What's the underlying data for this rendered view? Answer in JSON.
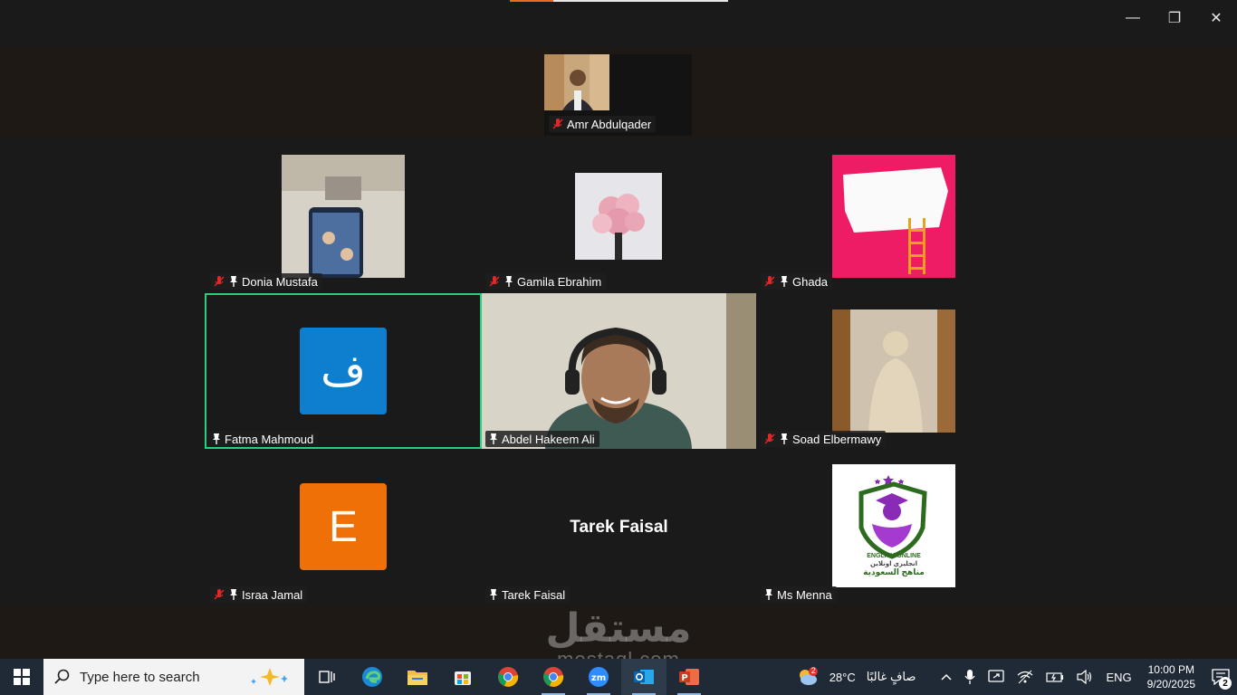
{
  "window": {
    "minimize_glyph": "—",
    "restore_glyph": "❐",
    "close_glyph": "✕",
    "load_progress": 0.2
  },
  "speaker": {
    "name": "Amr Abdulqader",
    "muted": true
  },
  "participants": [
    {
      "name": "Donia Mustafa",
      "muted": true,
      "pinned": true
    },
    {
      "name": "Gamila Ebrahim",
      "muted": true,
      "pinned": true
    },
    {
      "name": "Ghada",
      "muted": true,
      "pinned": true
    },
    {
      "name": "Fatma Mahmoud",
      "muted": false,
      "pinned": true,
      "avatar_letter": "ف",
      "avatar_color": "#0e7fcf",
      "active": true
    },
    {
      "name": "Abdel Hakeem Ali",
      "muted": false,
      "pinned": true
    },
    {
      "name": "Soad Elbermawy",
      "muted": true,
      "pinned": true
    },
    {
      "name": "Israa Jamal",
      "muted": true,
      "pinned": true,
      "avatar_letter": "E",
      "avatar_color": "#ee7007"
    },
    {
      "name": "Tarek Faisal",
      "muted": false,
      "pinned": true,
      "center_name": "Tarek Faisal"
    },
    {
      "name": "Ms Menna",
      "muted": false,
      "pinned": true,
      "logo_text_en": "ENGLISH ONLINE",
      "logo_text_ar1": "انجليزي اونلاين",
      "logo_text_ar2": "مناهج السعودية"
    }
  ],
  "watermark": {
    "arabic": "مستقل",
    "latin": "mostaql.com"
  },
  "taskbar": {
    "search_placeholder": "Type here to search",
    "weather_temp": "28°C",
    "weather_desc": "صافٍ غالبًا",
    "weather_badge": "2",
    "language": "ENG",
    "time": "10:00 PM",
    "date": "9/20/2025",
    "notification_count": "2"
  },
  "colors": {
    "active_border": "#26d07c",
    "mute_red": "#e02828"
  }
}
